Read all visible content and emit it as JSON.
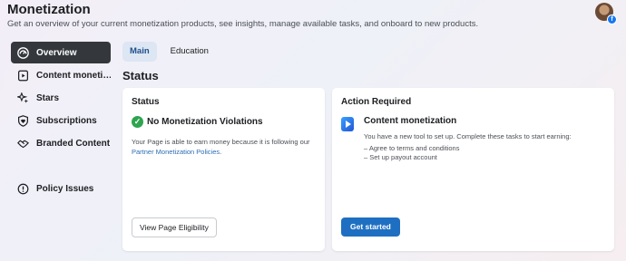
{
  "header": {
    "title": "Monetization",
    "subtitle": "Get an overview of your current monetization products, see insights, manage available tasks, and onboard to new products."
  },
  "sidebar": {
    "items": [
      {
        "label": "Overview",
        "icon": "speedometer-icon",
        "active": true
      },
      {
        "label": "Content moneti…",
        "icon": "play-document-icon"
      },
      {
        "label": "Stars",
        "icon": "stars-icon"
      },
      {
        "label": "Subscriptions",
        "icon": "shield-heart-icon"
      },
      {
        "label": "Branded Content",
        "icon": "handshake-icon"
      },
      {
        "label": "Policy Issues",
        "icon": "alert-circle-icon"
      }
    ]
  },
  "tabs": [
    {
      "label": "Main",
      "active": true
    },
    {
      "label": "Education"
    }
  ],
  "section_title": "Status",
  "status_card": {
    "title": "Status",
    "heading": "No Monetization Violations",
    "desc": "Your Page is able to earn money because it is following our",
    "link": "Partner Monetization Policies",
    "link_suffix": ".",
    "button": "View Page Eligibility"
  },
  "action_card": {
    "title": "Action Required",
    "heading": "Content monetization",
    "text": "You have a new tool to set up. Complete these tasks to start earning:",
    "tasks": [
      "– Agree to terms and conditions",
      "– Set up payout account"
    ],
    "button": "Get started"
  },
  "colors": {
    "primary_button": "#1e6fc2",
    "active_nav": "#34383d",
    "success": "#2ea44f",
    "link": "#2d6db5"
  }
}
